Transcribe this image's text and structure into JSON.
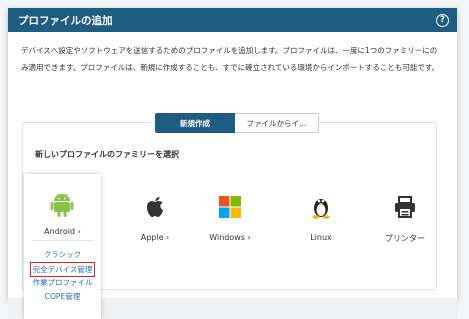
{
  "modal": {
    "title": "プロファイルの追加",
    "description": "デバイスへ設定やソフトウェアを送信するためのプロファイルを追加します。プロファイルは、一度に1つのファミリーにのみ適用できます。プロファイルは、新規に作成することも、すでに確立されている環境からインポートすることも可能です。"
  },
  "tabs": [
    {
      "label": "新規作成",
      "active": true
    },
    {
      "label": "ファイルからイ…",
      "active": false
    }
  ],
  "section_label": "新しいプロファイルのファミリーを選択",
  "families": {
    "android": "Android ›",
    "apple": "Apple ›",
    "windows": "Windows ›",
    "linux": "Linux",
    "printer": "プリンター"
  },
  "android_submenu": [
    "クラシック",
    "完全デバイス管理",
    "作業プロファイル",
    "COPE管理"
  ],
  "colors": {
    "header": "#1f5c82",
    "link": "#1f6fb0",
    "highlight": "#e02020",
    "android_green": "#8bc34a"
  }
}
